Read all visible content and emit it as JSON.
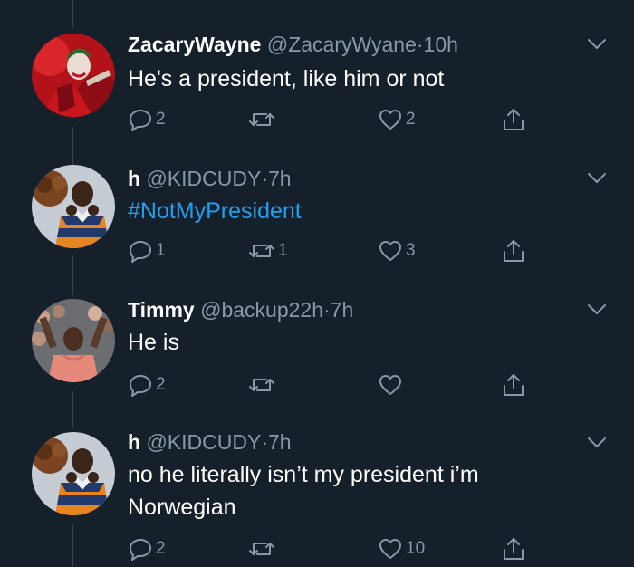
{
  "colors": {
    "background": "#15202b",
    "text_primary": "#ffffff",
    "text_secondary": "#8899a6",
    "link": "#1da1f2",
    "thread_line": "#38444d"
  },
  "tweets": [
    {
      "display_name": "ZacaryWayne",
      "handle": "@ZacaryWyane",
      "separator": "·",
      "time": "10h",
      "text": "He's a president, like him or not",
      "replies": "2",
      "retweets": "",
      "likes": "2",
      "avatar_icon": "joker-avatar"
    },
    {
      "display_name": "h",
      "handle": "@KIDCUDY",
      "separator": "·",
      "time": "7h",
      "text": "#NotMyPresident",
      "replies": "1",
      "retweets": "1",
      "likes": "3",
      "avatar_icon": "bear-avatar"
    },
    {
      "display_name": "Timmy",
      "handle": "@backup22h",
      "separator": "·",
      "time": "7h",
      "text": "He is",
      "replies": "2",
      "retweets": "",
      "likes": "",
      "avatar_icon": "crowd-avatar"
    },
    {
      "display_name": "h",
      "handle": "@KIDCUDY",
      "separator": "·",
      "time": "7h",
      "text": "no he literally isn’t my president i’m Norwegian",
      "replies": "2",
      "retweets": "",
      "likes": "10",
      "avatar_icon": "bear-avatar"
    }
  ]
}
